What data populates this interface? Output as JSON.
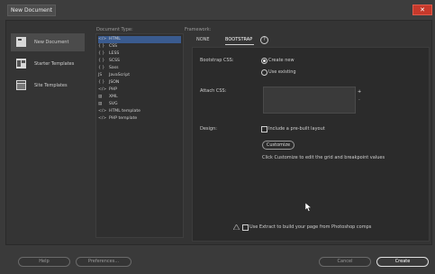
{
  "window": {
    "title": "New Document",
    "close_label": "✕"
  },
  "nav": {
    "items": [
      {
        "label": "New Document",
        "icon": "new-document-icon"
      },
      {
        "label": "Starter Templates",
        "icon": "starter-templates-icon"
      },
      {
        "label": "Site Templates",
        "icon": "site-templates-icon"
      }
    ]
  },
  "document_type": {
    "heading": "Document Type:",
    "items": [
      {
        "icon": "</>",
        "label": "HTML"
      },
      {
        "icon": "{ }",
        "label": "CSS"
      },
      {
        "icon": "{ }",
        "label": "LESS"
      },
      {
        "icon": "{ }",
        "label": "SCSS"
      },
      {
        "icon": "{ }",
        "label": "Sass"
      },
      {
        "icon": "JS",
        "label": "JavaScript"
      },
      {
        "icon": "{ }",
        "label": "JSON"
      },
      {
        "icon": "</>",
        "label": "PHP"
      },
      {
        "icon": "▤",
        "label": "XML"
      },
      {
        "icon": "▤",
        "label": "SVG"
      },
      {
        "icon": "</>",
        "label": "HTML template"
      },
      {
        "icon": "</>",
        "label": "PHP template"
      }
    ]
  },
  "framework": {
    "heading": "Framework:",
    "tabs": [
      "NONE",
      "BOOTSTRAP"
    ],
    "help_icon": "?",
    "bootstrap_css_label": "Bootstrap CSS:",
    "radio_create": "Create new",
    "radio_existing": "Use existing",
    "attach_css_label": "Attach CSS:",
    "add_icon": "+",
    "remove_icon": "-",
    "design_label": "Design:",
    "prebuilt_layout": "Include a pre-built layout",
    "customize_button": "Customize",
    "customize_hint": "Click Customize to edit the grid and breakpoint values",
    "extract_text": "Use Extract to build your page from Photoshop comps"
  },
  "footer": {
    "help": "Help",
    "preferences": "Preferences...",
    "cancel": "Cancel",
    "create": "Create"
  }
}
